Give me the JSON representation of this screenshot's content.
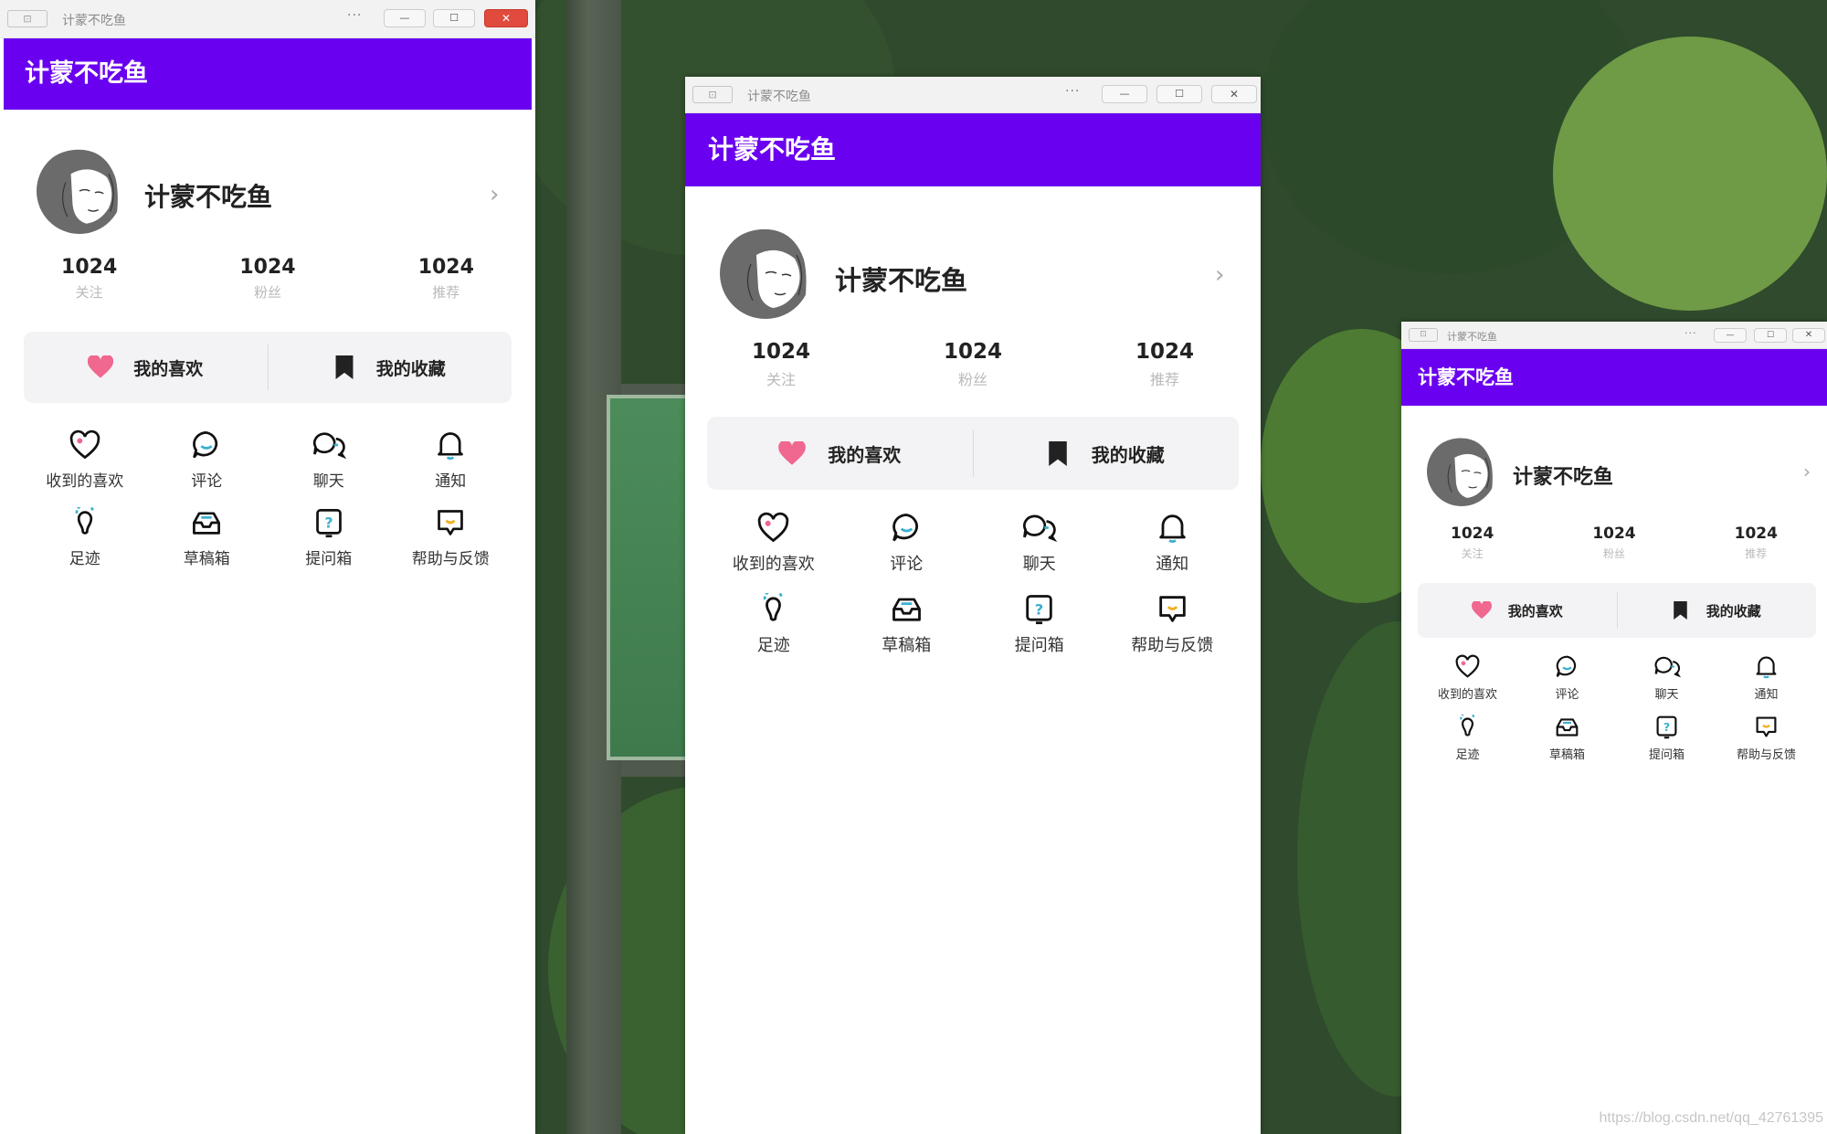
{
  "app_title": "计蒙不吃鱼",
  "header_title": "计蒙不吃鱼",
  "user_name": "计蒙不吃鱼",
  "stats": [
    {
      "value": "1024",
      "label": "关注"
    },
    {
      "value": "1024",
      "label": "粉丝"
    },
    {
      "value": "1024",
      "label": "推荐"
    }
  ],
  "favorites": {
    "likes_label": "我的喜欢",
    "collections_label": "我的收藏"
  },
  "menu": [
    {
      "label": "收到的喜欢",
      "icon": "heart-outline-icon"
    },
    {
      "label": "评论",
      "icon": "comment-bubble-icon"
    },
    {
      "label": "聊天",
      "icon": "chat-bubbles-icon"
    },
    {
      "label": "通知",
      "icon": "bell-icon"
    },
    {
      "label": "足迹",
      "icon": "footprint-icon"
    },
    {
      "label": "草稿箱",
      "icon": "inbox-tray-icon"
    },
    {
      "label": "提问箱",
      "icon": "question-box-icon"
    },
    {
      "label": "帮助与反馈",
      "icon": "feedback-icon"
    }
  ],
  "titlebar": {
    "more": "···",
    "minimize": "—",
    "maximize": "☐",
    "close": "✕"
  },
  "colors": {
    "accent": "#6a00f0",
    "heart": "#f0678f",
    "icon_teal": "#3ab0d0",
    "icon_yellow": "#f2b01e"
  },
  "watermark": "https://blog.csdn.net/qq_42761395"
}
